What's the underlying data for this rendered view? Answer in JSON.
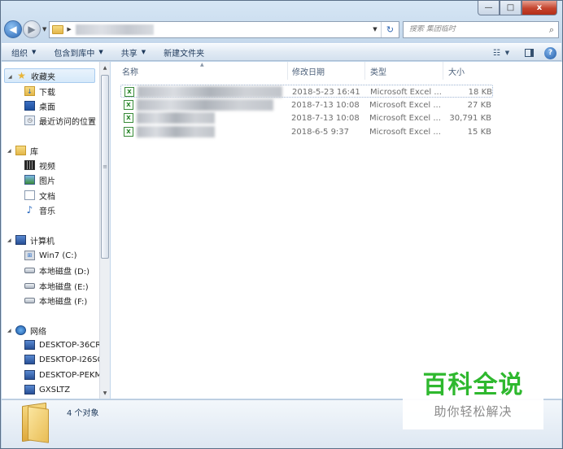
{
  "window": {
    "caption_buttons": {
      "minimize": "—",
      "maximize": "□",
      "close": "x"
    }
  },
  "address": {
    "refresh_icon": "↻",
    "search_placeholder": "搜索 集团临时"
  },
  "toolbar": {
    "organize": "组织",
    "include_in_library": "包含到库中",
    "share": "共享",
    "new_folder": "新建文件夹"
  },
  "sidebar": {
    "favorites": "收藏夹",
    "downloads": "下载",
    "desktop": "桌面",
    "recent": "最近访问的位置",
    "libraries": "库",
    "videos": "视频",
    "pictures": "图片",
    "documents": "文档",
    "music": "音乐",
    "computer": "计算机",
    "drives": [
      {
        "label": "Win7 (C:)"
      },
      {
        "label": "本地磁盘 (D:)"
      },
      {
        "label": "本地磁盘 (E:)"
      },
      {
        "label": "本地磁盘 (F:)"
      }
    ],
    "network": "网络",
    "network_nodes": [
      {
        "label": "DESKTOP-36CRI"
      },
      {
        "label": "DESKTOP-I26SC"
      },
      {
        "label": "DESKTOP-PEKM"
      },
      {
        "label": "GXSLTZ"
      }
    ]
  },
  "columns": {
    "name": "名称",
    "modified": "修改日期",
    "type": "类型",
    "size": "大小"
  },
  "files": [
    {
      "modified": "2018-5-23 16:41",
      "type": "Microsoft Excel ...",
      "size": "18 KB"
    },
    {
      "modified": "2018-7-13 10:08",
      "type": "Microsoft Excel ...",
      "size": "27 KB"
    },
    {
      "modified": "2018-7-13 10:08",
      "type": "Microsoft Excel ...",
      "size": "30,791 KB"
    },
    {
      "modified": "2018-6-5 9:37",
      "type": "Microsoft Excel ...",
      "size": "15 KB"
    }
  ],
  "status": {
    "item_count": "4 个对象"
  },
  "watermark": {
    "title": "百科全说",
    "subtitle": "助你轻松解决"
  }
}
